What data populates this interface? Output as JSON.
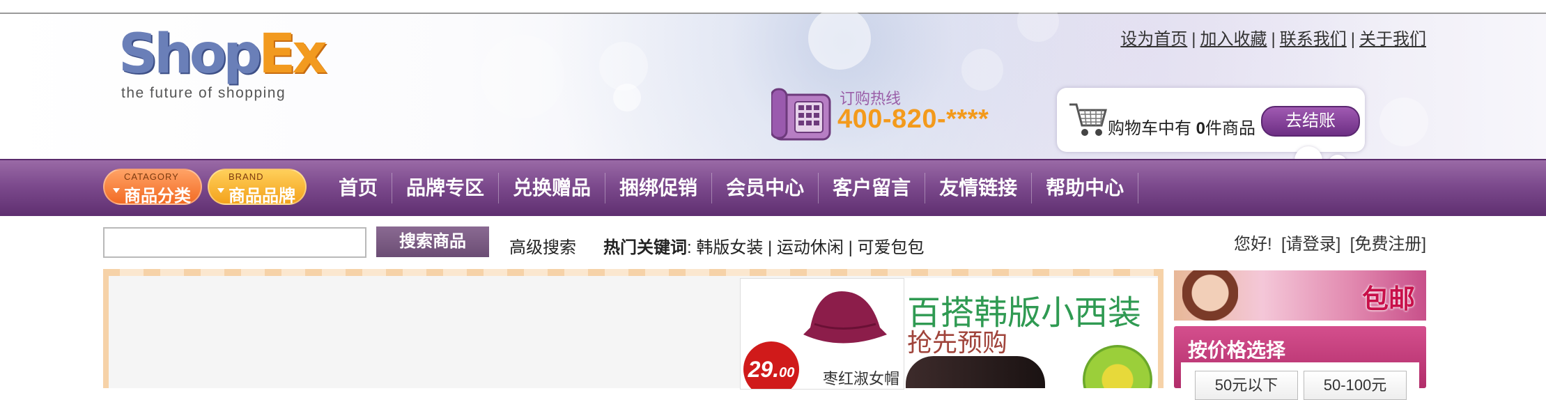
{
  "logo": {
    "word1": "Shop",
    "word2": "Ex",
    "tagline": "the future of shopping"
  },
  "toplinks": [
    "设为首页",
    "加入收藏",
    "联系我们",
    "关于我们"
  ],
  "hotline": {
    "label": "订购热线",
    "number": "400-820-****"
  },
  "cart": {
    "text_before": "购物车中有 ",
    "count": "0",
    "text_after": "件商品",
    "checkout": "去结账"
  },
  "nav": {
    "category": {
      "small": "CATAGORY",
      "label": "商品分类"
    },
    "brand": {
      "small": "BRAND",
      "label": "商品品牌"
    },
    "items": [
      "首页",
      "品牌专区",
      "兑换赠品",
      "捆绑促销",
      "会员中心",
      "客户留言",
      "友情链接",
      "帮助中心"
    ]
  },
  "search": {
    "value": "",
    "button": "搜索商品",
    "advanced": "高级搜索"
  },
  "hot_keywords": {
    "label": "热门关键词",
    "items": [
      "韩版女装",
      "运动休闲",
      "可爱包包"
    ]
  },
  "login": {
    "greeting": "您好!",
    "login": "[请登录]",
    "register": "[免费注册]"
  },
  "banner": {
    "promo1": {
      "price": "29.",
      "price_small": "00",
      "name": "枣红淑女帽"
    },
    "promo2": {
      "title": "百搭韩版小西装",
      "subtitle": "抢先预购"
    }
  },
  "side_ad": {
    "text": "包邮"
  },
  "price_filter": {
    "title": "按价格选择",
    "options": [
      "50元以下",
      "50-100元"
    ]
  }
}
